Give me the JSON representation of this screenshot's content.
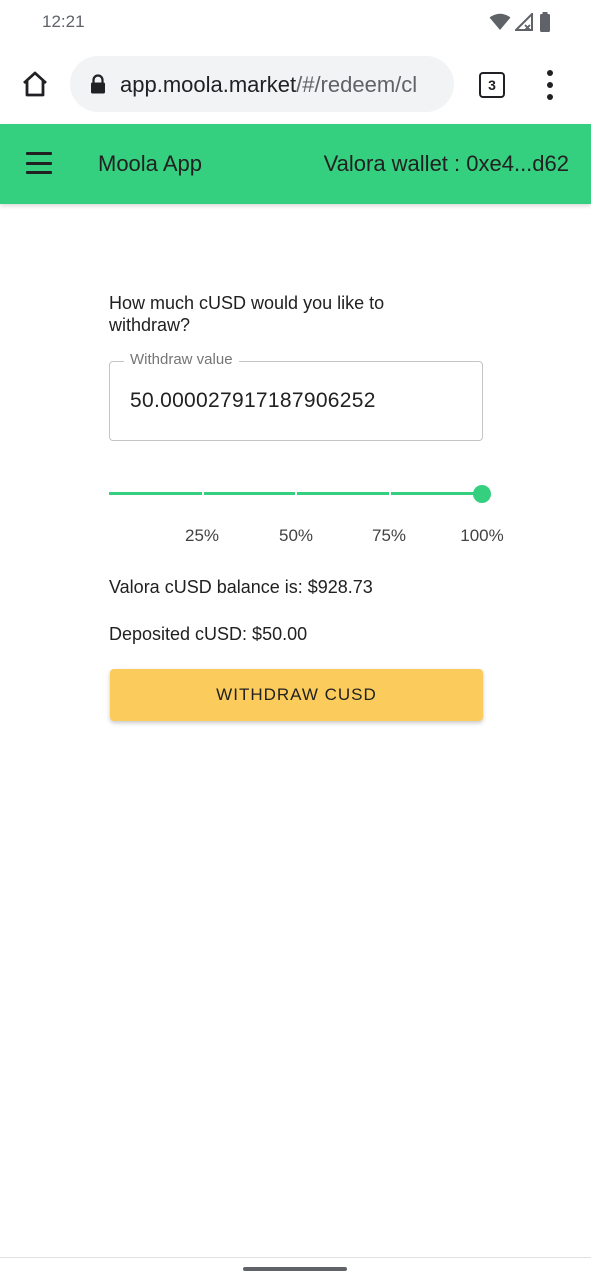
{
  "status_bar": {
    "time": "12:21"
  },
  "browser": {
    "url_host": "app.moola.market",
    "url_path": "/#/redeem/cl",
    "tab_count": "3"
  },
  "app_bar": {
    "title": "Moola App",
    "wallet_label": "Valora wallet : 0xe4...d62",
    "accent_color": "#35d07f"
  },
  "form": {
    "question": "How much cUSD would you like to withdraw?",
    "field_label": "Withdraw value",
    "field_value": "50.000027917187906252",
    "slider": {
      "value_percent": 100,
      "marks": [
        "25%",
        "50%",
        "75%",
        "100%"
      ]
    },
    "balance_text": "Valora cUSD balance is: $928.73",
    "deposited_text": "Deposited cUSD: $50.00",
    "withdraw_button": "WITHDRAW CUSD",
    "button_color": "#fbcc5c"
  }
}
